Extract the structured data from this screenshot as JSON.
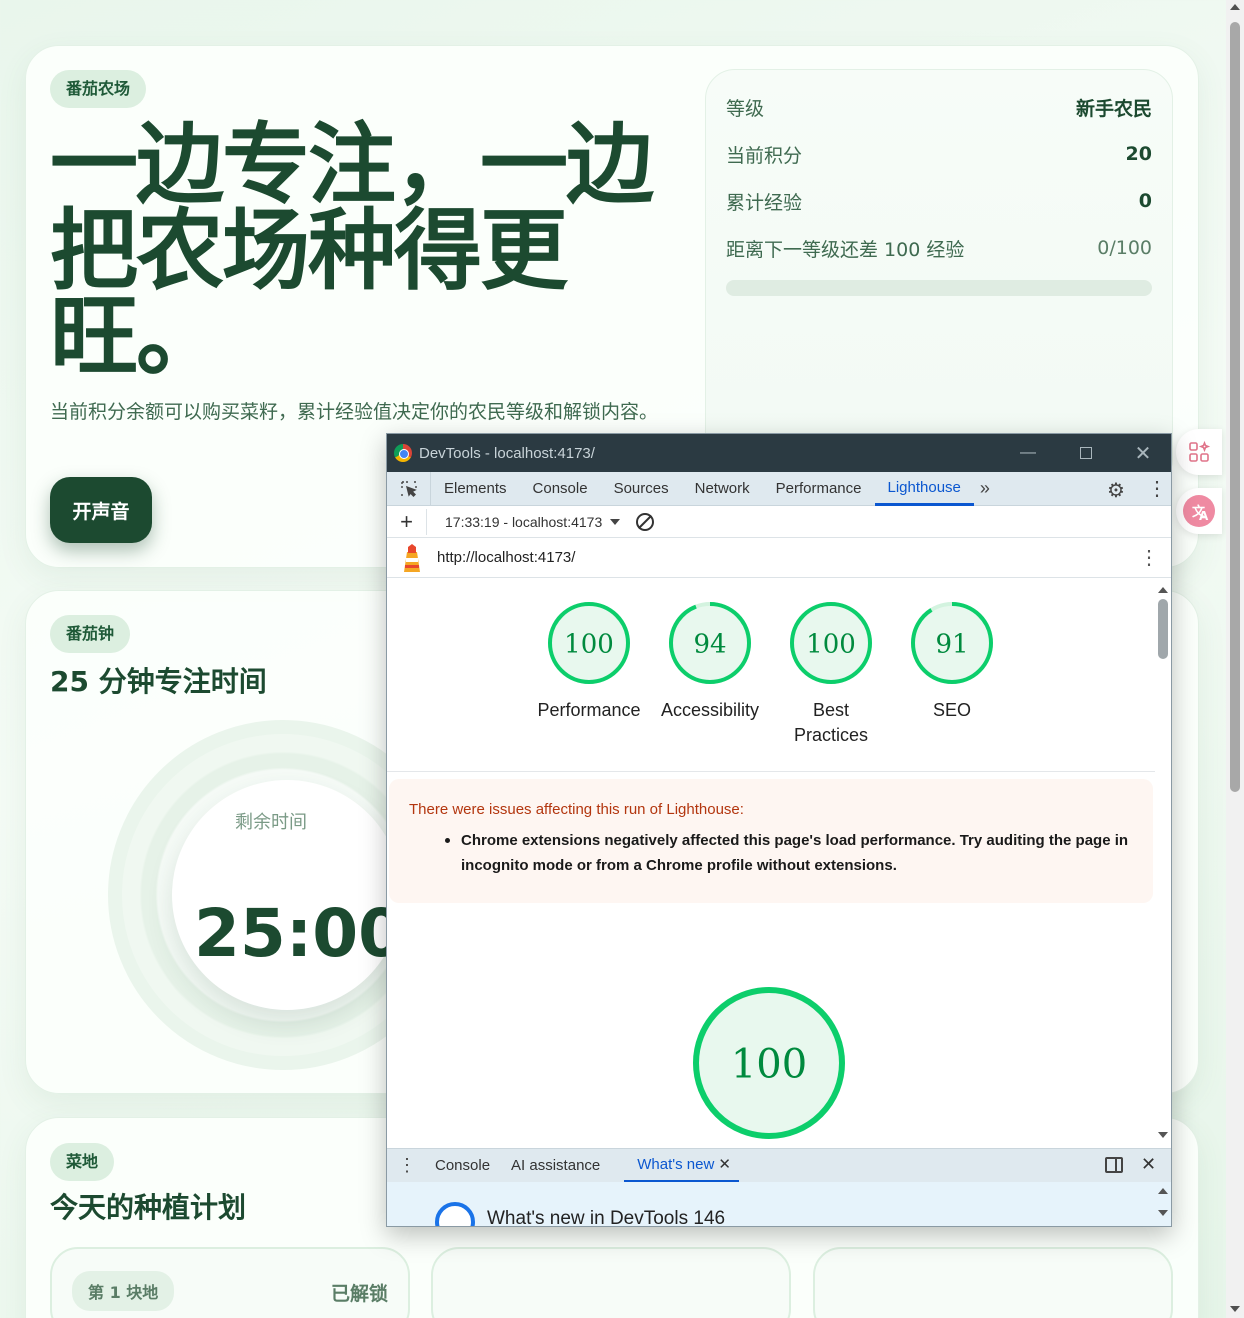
{
  "hero": {
    "tag": "番茄农场",
    "title": "一边专注，一边把农场种得更旺。",
    "description": "当前积分余额可以购买菜籽，累计经验值决定你的农民等级和解锁内容。",
    "sound_button": "开声音"
  },
  "stats": {
    "rows": [
      {
        "label": "等级",
        "value": "新手农民"
      },
      {
        "label": "当前积分",
        "value": "20"
      },
      {
        "label": "累计经验",
        "value": "0"
      },
      {
        "label": "距离下一等级还差 100 经验",
        "value": "0/100"
      }
    ],
    "progress_fraction": 0
  },
  "pomodoro": {
    "tag": "番茄钟",
    "title": "25 分钟专注时间",
    "remaining_label": "剩余时间",
    "time": "25:00"
  },
  "garden": {
    "tag": "菜地",
    "title": "今天的种植计划",
    "plots": [
      {
        "name": "第 1 块地",
        "status": "已解锁"
      }
    ]
  },
  "devtools": {
    "window_title": "DevTools - localhost:4173/",
    "tabs": [
      "Elements",
      "Console",
      "Sources",
      "Network",
      "Performance",
      "Lighthouse"
    ],
    "active_tab": "Lighthouse",
    "report_selector": "17:33:19 - localhost:4173",
    "url": "http://localhost:4173/",
    "scores": [
      {
        "value": 100,
        "label": "Performance"
      },
      {
        "value": 94,
        "label": "Accessibility"
      },
      {
        "value": 100,
        "label": "Best Practices"
      },
      {
        "value": 91,
        "label": "SEO"
      }
    ],
    "issues_heading": "There were issues affecting this run of Lighthouse:",
    "issues_text": "Chrome extensions negatively affected this page's load performance. Try auditing the page in incognito mode or from a Chrome profile without extensions.",
    "big_score": 100,
    "drawer_tabs": [
      "Console",
      "AI assistance",
      "What's new"
    ],
    "drawer_active": "What's new",
    "drawer_heading": "What's new in DevTools 146"
  },
  "colors": {
    "brand": "#1c4a30",
    "gauge_pass": "#0cce6b",
    "gauge_text": "#008a3e",
    "devtools_accent": "#0b57d0"
  }
}
